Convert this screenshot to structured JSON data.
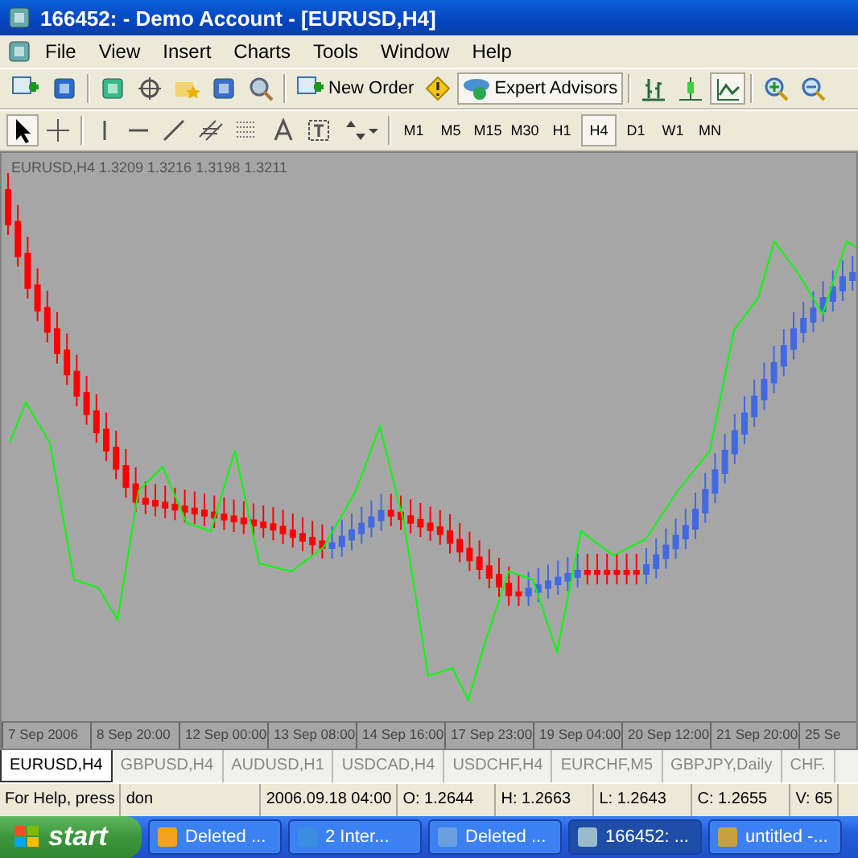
{
  "window": {
    "title": "166452:  - Demo Account - [EURUSD,H4]"
  },
  "menu": [
    "File",
    "View",
    "Insert",
    "Charts",
    "Tools",
    "Window",
    "Help"
  ],
  "toolbar": {
    "new_order": "New Order",
    "expert_advisors": {
      "label": "Expert Advisors",
      "on": true
    }
  },
  "timeframes": [
    {
      "label": "M1",
      "selected": false
    },
    {
      "label": "M5",
      "selected": false
    },
    {
      "label": "M15",
      "selected": false
    },
    {
      "label": "M30",
      "selected": false
    },
    {
      "label": "H1",
      "selected": false
    },
    {
      "label": "H4",
      "selected": true
    },
    {
      "label": "D1",
      "selected": false
    },
    {
      "label": "W1",
      "selected": false
    },
    {
      "label": "MN",
      "selected": false
    }
  ],
  "chart": {
    "header": "EURUSD,H4  1.3209 1.3216 1.3198 1.3211",
    "time_labels": [
      "7 Sep 2006",
      "8 Sep 20:00",
      "12 Sep 00:00",
      "13 Sep 08:00",
      "14 Sep 16:00",
      "17 Sep 23:00",
      "19 Sep 04:00",
      "20 Sep 12:00",
      "21 Sep 20:00",
      "25 Se"
    ]
  },
  "chart_tabs": [
    {
      "label": "EURUSD,H4",
      "selected": true
    },
    {
      "label": "GBPUSD,H4",
      "selected": false
    },
    {
      "label": "AUDUSD,H1",
      "selected": false
    },
    {
      "label": "USDCAD,H4",
      "selected": false
    },
    {
      "label": "USDCHF,H4",
      "selected": false
    },
    {
      "label": "EURCHF,M5",
      "selected": false
    },
    {
      "label": "GBPJPY,Daily",
      "selected": false
    },
    {
      "label": "CHF.",
      "selected": false
    }
  ],
  "status_bar": [
    "For Help, press",
    "don",
    "2006.09.18 04:00",
    "O: 1.2644",
    "H: 1.2663",
    "L: 1.2643",
    "C: 1.2655",
    "V: 65"
  ],
  "taskbar": {
    "start": "start",
    "tasks": [
      {
        "label": "Deleted ...",
        "selected": false
      },
      {
        "label": "2 Inter...",
        "selected": false
      },
      {
        "label": "Deleted ...",
        "selected": false
      },
      {
        "label": "166452: ...",
        "selected": true
      },
      {
        "label": "untitled -...",
        "selected": false
      }
    ]
  }
}
